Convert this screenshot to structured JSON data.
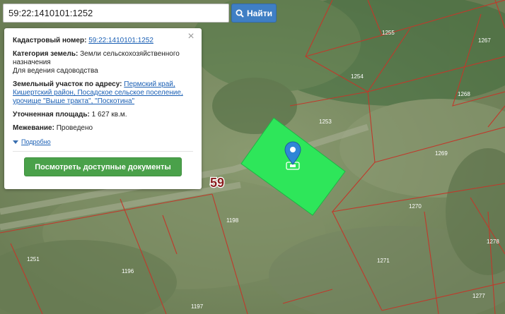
{
  "search": {
    "value": "59:22:1410101:1252",
    "button_label": "Найти"
  },
  "card": {
    "cadastral_label": "Кадастровый номер:",
    "cadastral_value": "59:22:1410101:1252",
    "category_label": "Категория земель:",
    "category_line1": "Земли сельскохозяйственного",
    "category_line2": "назначения",
    "category_line3": "Для ведения садоводства",
    "address_label": "Земельный участок по адресу:",
    "address_line1": "Пермский край,",
    "address_line2": "Кишертский район, Посадское сельское поселение,",
    "address_line3": "урочище \"Выше тракта\", \"Поскотина\"",
    "area_label": "Уточненная площадь:",
    "area_value": "1 627 кв.м.",
    "survey_label": "Межевание:",
    "survey_value": "Проведено",
    "more_label": "Подробно",
    "docs_button": "Посмотреть доступные документы",
    "close_glyph": "×"
  },
  "map": {
    "region_label": "59",
    "parcels": [
      "1255",
      "1267",
      "1254",
      "1268",
      "1253",
      "1269",
      "1270",
      "1198",
      "1278",
      "1251",
      "1196",
      "1271",
      "1197",
      "1277"
    ],
    "colors": {
      "selected_parcel": "#2ee65a",
      "boundary": "#c0392b",
      "marker": "#2f86d6",
      "region_label": "#8a1e1e"
    }
  }
}
